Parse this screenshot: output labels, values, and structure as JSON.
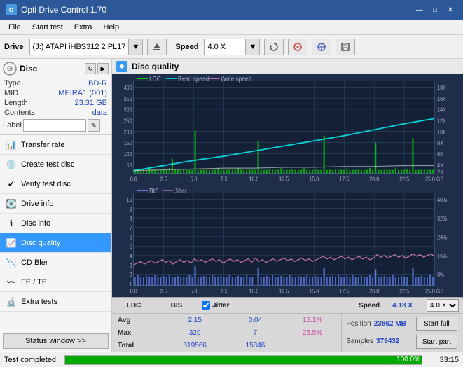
{
  "titleBar": {
    "title": "Opti Drive Control 1.70",
    "minimizeIcon": "—",
    "maximizeIcon": "□",
    "closeIcon": "✕"
  },
  "menuBar": {
    "items": [
      "File",
      "Start test",
      "Extra",
      "Help"
    ]
  },
  "toolbar": {
    "driveLabel": "Drive",
    "driveName": "(J:)  ATAPI iHBS312  2 PL17",
    "speedLabel": "Speed",
    "speedValue": "4.0 X"
  },
  "sidebar": {
    "discSection": {
      "title": "Disc",
      "type": {
        "label": "Type",
        "value": "BD-R"
      },
      "mid": {
        "label": "MID",
        "value": "MEIRA1 (001)"
      },
      "length": {
        "label": "Length",
        "value": "23.31 GB"
      },
      "contents": {
        "label": "Contents",
        "value": "data"
      },
      "labelField": {
        "label": "Label",
        "placeholder": ""
      }
    },
    "navItems": [
      {
        "id": "transfer-rate",
        "label": "Transfer rate",
        "active": false
      },
      {
        "id": "create-test-disc",
        "label": "Create test disc",
        "active": false
      },
      {
        "id": "verify-test-disc",
        "label": "Verify test disc",
        "active": false
      },
      {
        "id": "drive-info",
        "label": "Drive info",
        "active": false
      },
      {
        "id": "disc-info",
        "label": "Disc info",
        "active": false
      },
      {
        "id": "disc-quality",
        "label": "Disc quality",
        "active": true
      },
      {
        "id": "cd-bler",
        "label": "CD Bler",
        "active": false
      },
      {
        "id": "fe-te",
        "label": "FE / TE",
        "active": false
      },
      {
        "id": "extra-tests",
        "label": "Extra tests",
        "active": false
      }
    ],
    "statusBtn": "Status window >>"
  },
  "contentHeader": {
    "title": "Disc quality"
  },
  "chart1": {
    "title": "LDC",
    "legend": [
      "LDC",
      "Read speed",
      "Write speed"
    ],
    "yMax": 400,
    "yAxisLabels": [
      "400",
      "350",
      "300",
      "250",
      "200",
      "150",
      "100",
      "50"
    ],
    "yAxisRight": [
      "18X",
      "16X",
      "14X",
      "12X",
      "10X",
      "8X",
      "6X",
      "4X",
      "2X"
    ],
    "xAxisLabels": [
      "0.0",
      "2.5",
      "5.0",
      "7.5",
      "10.0",
      "12.5",
      "15.0",
      "17.5",
      "20.0",
      "22.5",
      "25.0 GB"
    ]
  },
  "chart2": {
    "title": "BIS",
    "legend": [
      "BIS",
      "Jitter"
    ],
    "yMax": 10,
    "yAxisLabels": [
      "10",
      "9",
      "8",
      "7",
      "6",
      "5",
      "4",
      "3",
      "2",
      "1"
    ],
    "yAxisRight": [
      "40%",
      "32%",
      "24%",
      "16%",
      "8%"
    ],
    "xAxisLabels": [
      "0.0",
      "2.5",
      "5.0",
      "7.5",
      "10.0",
      "12.5",
      "15.0",
      "17.5",
      "20.0",
      "22.5",
      "25.0 GB"
    ]
  },
  "statsBar": {
    "columns": [
      "LDC",
      "BIS",
      "",
      "Jitter",
      "Speed",
      ""
    ],
    "jitterChecked": true,
    "speedValue": "4.18 X",
    "speedDropdown": "4.0 X",
    "avg": {
      "ldc": "2.15",
      "bis": "0.04",
      "jitter": "15.1%"
    },
    "max": {
      "ldc": "320",
      "bis": "7",
      "jitter": "25.5%"
    },
    "total": {
      "ldc": "819566",
      "bis": "15846"
    },
    "position": {
      "label": "Position",
      "value": "23862 MB"
    },
    "samples": {
      "label": "Samples",
      "value": "379432"
    },
    "rowLabels": [
      "Avg",
      "Max",
      "Total"
    ],
    "startFull": "Start full",
    "startPart": "Start part"
  },
  "bottomBar": {
    "statusText": "Test completed",
    "progressPercent": 100,
    "progressLabel": "100.0%",
    "time": "33:15"
  }
}
